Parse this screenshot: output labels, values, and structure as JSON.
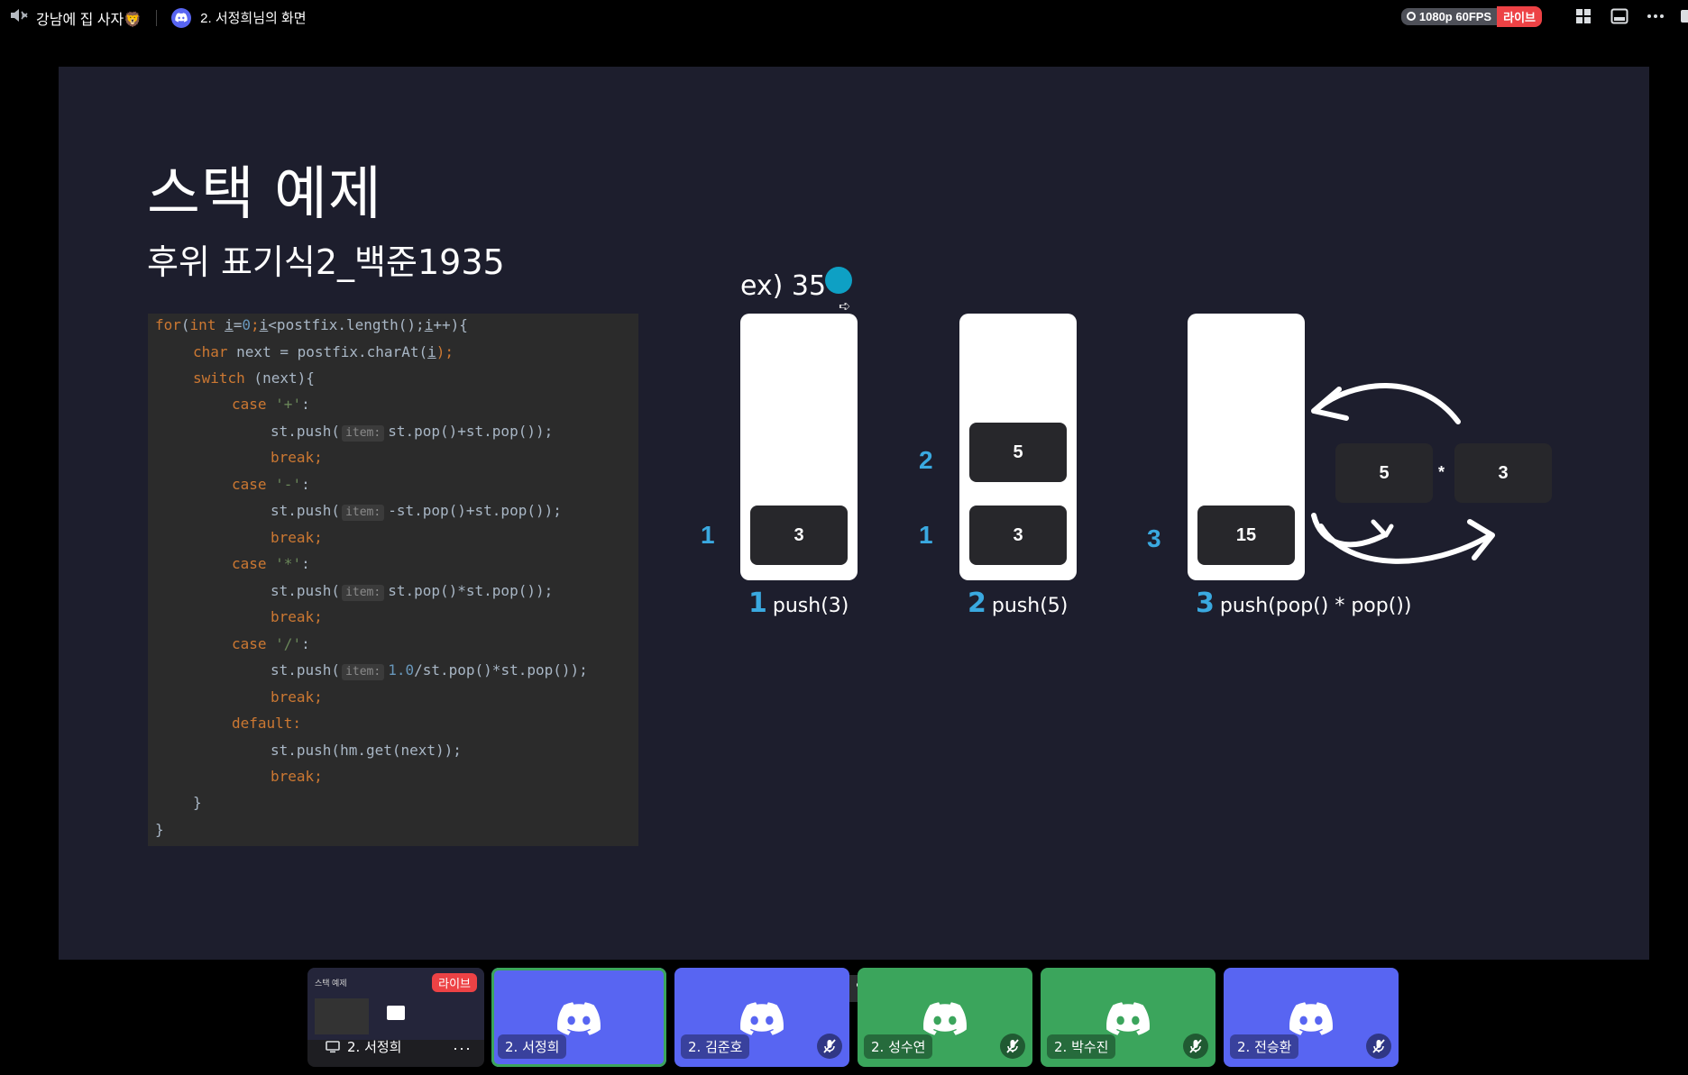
{
  "topbar": {
    "channel_name": "강남에 집 사자🦁",
    "stream_title": "2. 서정희님의 화면",
    "quality": "1080p 60FPS",
    "live_label": "라이브"
  },
  "slide": {
    "title": "스택 예제",
    "subtitle": "후위 표기식2_백준1935",
    "code": {
      "for_kw": "for",
      "int_kw": "int",
      "i_var": "i",
      "eq": "=",
      "zero": "0",
      "i_var2": "i",
      "cond": "<postfix.length();",
      "i_var3": "i",
      "incr": "++){",
      "char_kw": "char",
      "next_decl": " next = postfix.charAt(",
      "i_var4": "i",
      "next_end": ");",
      "switch_kw": "switch",
      "switch_rest": " (next){",
      "case_kw": "case",
      "case_plus": "'+'",
      "case_minus": "'-'",
      "case_mul": "'*'",
      "case_div": "'/'",
      "colon": ":",
      "push_open": "st.push(",
      "hint": "item:",
      "expr_plus": "st.pop()+st.pop());",
      "expr_minus": "-st.pop()+st.pop());",
      "expr_mul": "st.pop()*st.pop());",
      "one_point_zero": "1.0",
      "expr_div": "/st.pop()*st.pop());",
      "break_kw": "break;",
      "default_kw": "default:",
      "default_push": "st.push(hm.get(next));",
      "close_inner": "}",
      "close_outer": "}"
    },
    "example": "ex) 35*",
    "stack1": {
      "cells": [
        "3"
      ],
      "levels": [
        "1"
      ],
      "step": "1",
      "caption": "push(3)"
    },
    "stack2": {
      "cells": [
        "5",
        "3"
      ],
      "levels": [
        "2",
        "1"
      ],
      "step": "2",
      "caption": "push(5)"
    },
    "stack3": {
      "cells": [
        "15"
      ],
      "levels": [
        "3"
      ],
      "step": "3",
      "caption": "push(pop() * pop())"
    },
    "operation": {
      "left": "5",
      "op": "*",
      "right": "3"
    }
  },
  "participants": [
    {
      "name": "2. 서정희",
      "type": "screen-preview",
      "badge": "라이브",
      "preview_title": "스택 예제"
    },
    {
      "name": "2. 서정희",
      "color": "#5865f2",
      "muted": false
    },
    {
      "name": "2. 김준호",
      "color": "#5865f2",
      "muted": true
    },
    {
      "name": "2. 성수연",
      "color": "#3ba55c",
      "muted": true
    },
    {
      "name": "2. 박수진",
      "color": "#3ba55c",
      "muted": true
    },
    {
      "name": "2. 전승환",
      "color": "#5865f2",
      "muted": true
    }
  ]
}
